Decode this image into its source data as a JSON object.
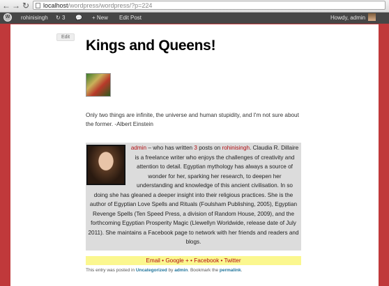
{
  "browser": {
    "url_host": "localhost",
    "url_path": "/wordpress/wordpress/?p=224"
  },
  "adminbar": {
    "site_name": "rohinisingh",
    "updates_count": "3",
    "new_label": "+ New",
    "edit_post_label": "Edit Post",
    "howdy": "Howdy, admin"
  },
  "post": {
    "edit_label": "Edit",
    "title": "Kings and Queens!",
    "quote": "Only two things are infinite, the universe and human stupidity, and I'm not sure about the former. -Albert Einstein"
  },
  "author_box": {
    "author_link": "admin",
    "text_1": " – who has written ",
    "post_count": "3",
    "text_2": " posts on ",
    "site_link": "rohinisingh",
    "text_3": ".",
    "bio": "Claudia R. Dillaire is a freelance writer who enjoys the challenges of creativity and attention to detail. Egyptian mythology has always a source of wonder for her, sparking her research, to deepen her understanding and knowledge of this ancient civilisation. In so doing she has gleaned a deeper insight into their religious practices. She is the author of Egyptian Love Spells and Rituals (Foulsham Publishing, 2005), Egyptian Revenge Spells (Ten Speed Press, a division of Random House, 2009), and the forthcoming Egyptian Prosperity Magic (Llewellyn Worldwide, release date of July 2011). She maintains a Facebook page to network with her friends and readers and blogs."
  },
  "share": {
    "email": "Email",
    "sep1": " • ",
    "google": "Google +",
    "sep2": " • ",
    "facebook": "Facebook",
    "sep3": " • ",
    "twitter": "Twitter"
  },
  "meta": {
    "prefix": "This entry was posted in ",
    "category": "Uncategorized",
    "by": " by ",
    "author": "admin",
    "bookmark": ". Bookmark the ",
    "permalink": "permalink",
    "end": "."
  }
}
